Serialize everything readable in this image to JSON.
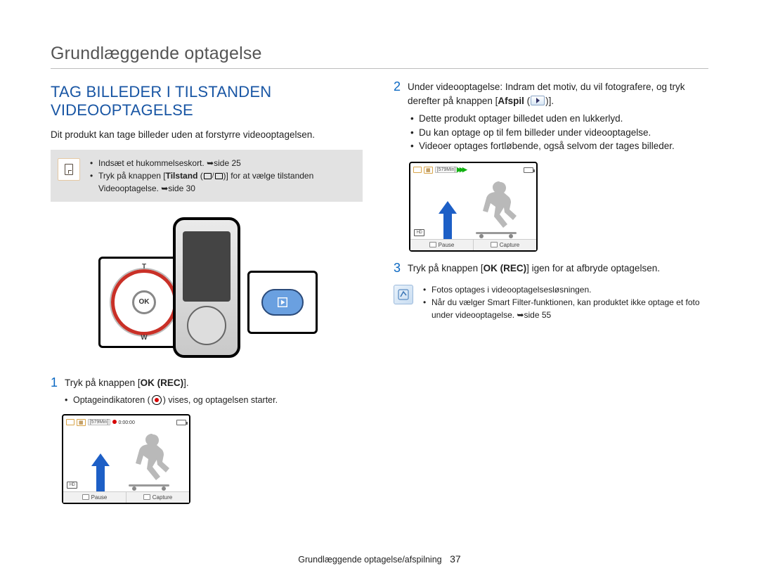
{
  "header": {
    "title": "Grundlæggende optagelse"
  },
  "section": {
    "title": "TAG BILLEDER I TILSTANDEN VIDEOOPTAGELSE",
    "intro": "Dit produkt kan tage billeder uden at forstyrre videooptagelsen."
  },
  "prereq": {
    "items": [
      {
        "pre": "Indsæt et hukommelseskort. ",
        "ref": "➥side 25"
      },
      {
        "pre": "Tryk på knappen [",
        "bold": "Tilstand",
        "mid": " (",
        "post": ")] for at vælge tilstanden Videooptagelse. ",
        "ref": "➥side 30"
      }
    ]
  },
  "dial": {
    "ok": "OK",
    "t": "T",
    "w": "W"
  },
  "step1": {
    "num": "1",
    "pre": "Tryk på knappen [",
    "bold": "OK (REC)",
    "post": "].",
    "bullet_pre": "Optageindikatoren (",
    "bullet_post": ") vises, og optagelsen starter."
  },
  "ss1": {
    "time_remaining": "[579Min]",
    "rec_time": "0:00:00",
    "hd": "HD",
    "pause": "Pause",
    "capture": "Capture"
  },
  "step2": {
    "num": "2",
    "pre": "Under videooptagelse: Indram det motiv, du vil fotografere, og tryk derefter på knappen [",
    "bold": "Afspil",
    "mid": " (",
    "post": ")].",
    "bullets": [
      "Dette produkt optager billedet uden en lukkerlyd.",
      "Du kan optage op til fem billeder under videooptagelse.",
      "Videoer optages fortløbende, også selvom der tages billeder."
    ]
  },
  "ss2": {
    "time_remaining": "[579Min]",
    "hd": "HD",
    "pause": "Pause",
    "capture": "Capture"
  },
  "step3": {
    "num": "3",
    "pre": "Tryk på knappen [",
    "bold": "OK (REC)",
    "post": "] igen for at afbryde optagelsen."
  },
  "note": {
    "items": [
      "Fotos optages i videooptagelsesløsningen.",
      {
        "text": "Når du vælger Smart Filter-funktionen, kan produktet ikke optage et foto under videooptagelse. ",
        "ref": "➥side 55"
      }
    ]
  },
  "footer": {
    "chapter": "Grundlæggende optagelse/afspilning",
    "page": "37"
  }
}
